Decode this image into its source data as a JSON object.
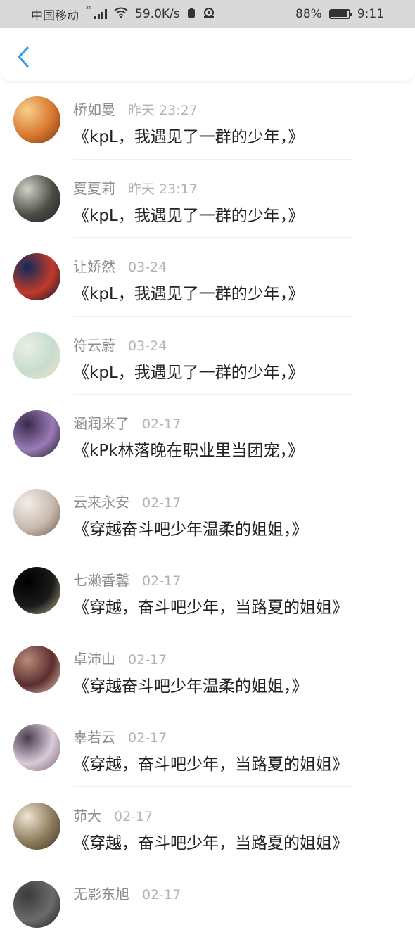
{
  "status_bar": {
    "carrier": "中国移动",
    "network": "²⁶",
    "speed": "59.0K/s",
    "battery": "88%",
    "time": "9:11"
  },
  "nav": {
    "back_icon": "chevron-left-icon",
    "accent": "#2f9be0"
  },
  "comments": [
    {
      "name": "桥如曼",
      "time": "昨天 23:27",
      "text": "《kpL，我遇见了一群的少年，》",
      "avatar_colors": [
        "#f6d08a",
        "#d9762f",
        "#6a3a16"
      ]
    },
    {
      "name": "夏夏莉",
      "time": "昨天 23:17",
      "text": "《kpL，我遇见了一群的少年，》",
      "avatar_colors": [
        "#cfd3c8",
        "#4b4d44",
        "#1f1f1f"
      ]
    },
    {
      "name": "让娇然",
      "time": "03-24",
      "text": "《kpL，我遇见了一群的少年，》",
      "avatar_colors": [
        "#0f2a5c",
        "#c23a2a",
        "#0a1530"
      ]
    },
    {
      "name": "符云蔚",
      "time": "03-24",
      "text": "《kpL，我遇见了一群的少年，》",
      "avatar_colors": [
        "#e8f0e0",
        "#c7dcd0",
        "#f2e2c4"
      ]
    },
    {
      "name": "涵润来了",
      "time": "02-17",
      "text": "《kPk林落晚在职业里当团宠，》",
      "avatar_colors": [
        "#3a2a4a",
        "#9a7bb8",
        "#1b1422"
      ]
    },
    {
      "name": "云来永安",
      "time": "02-17",
      "text": "《穿越奋斗吧少年温柔的姐姐，》",
      "avatar_colors": [
        "#f3eeea",
        "#c9b9ad",
        "#6f5a4e"
      ]
    },
    {
      "name": "七濑香馨",
      "time": "02-17",
      "text": "《穿越，奋斗吧少年，当路夏的姐姐》",
      "avatar_colors": [
        "#000000",
        "#1a1a1a",
        "#b9b08a"
      ]
    },
    {
      "name": "卓沛山",
      "time": "02-17",
      "text": "《穿越奋斗吧少年温柔的姐姐，》",
      "avatar_colors": [
        "#b98a7a",
        "#5a2e2e",
        "#e6c9bb"
      ]
    },
    {
      "name": "辜若云",
      "time": "02-17",
      "text": "《穿越，奋斗吧少年，当路夏的姐姐》",
      "avatar_colors": [
        "#4a3b4f",
        "#d9cbd8",
        "#7a5b74"
      ]
    },
    {
      "name": "茆大",
      "time": "02-17",
      "text": "《穿越，奋斗吧少年，当路夏的姐姐》",
      "avatar_colors": [
        "#efe6d4",
        "#8c7a5a",
        "#3e352a"
      ]
    },
    {
      "name": "无影东旭",
      "time": "02-17",
      "text": "",
      "avatar_colors": [
        "#3a3a3a",
        "#6b6b6b",
        "#1c1c1c"
      ]
    }
  ]
}
